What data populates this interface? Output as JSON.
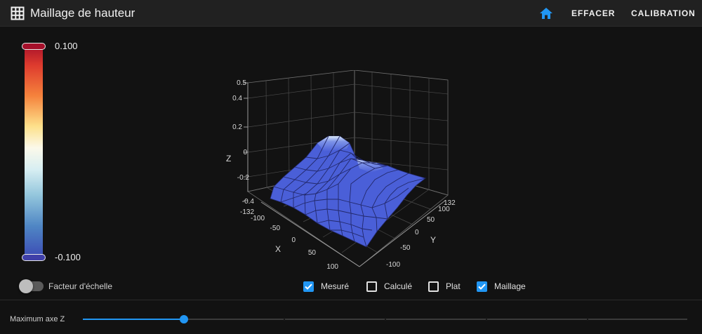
{
  "toolbar": {
    "title": "Maillage de hauteur",
    "effacer_label": "EFFACER",
    "calibration_label": "CALIBRATION",
    "home_icon": "home-icon",
    "title_icon": "grid-icon",
    "accent": "#2196f3"
  },
  "legend": {
    "max_label": "0.100",
    "min_label": "-0.100",
    "scale_label": "Facteur d'échelle",
    "scale_enabled": false
  },
  "options": {
    "mesure": {
      "label": "Mesuré",
      "checked": true
    },
    "calcule": {
      "label": "Calculé",
      "checked": false
    },
    "plat": {
      "label": "Plat",
      "checked": false
    },
    "maillage": {
      "label": "Maillage",
      "checked": true
    }
  },
  "slider": {
    "label": "Maximum axe Z",
    "value_fraction": 0.167
  },
  "chart_data": {
    "type": "surface3d",
    "axes": {
      "x": {
        "label": "X",
        "ticks": [
          "-132",
          "-100",
          "-50",
          "0",
          "50",
          "100"
        ]
      },
      "y": {
        "label": "Y",
        "ticks": [
          "-100",
          "-50",
          "0",
          "50",
          "100",
          "132"
        ]
      },
      "z": {
        "label": "Z",
        "ticks": [
          "-0.4",
          "-0.2",
          "0",
          "0.2",
          "0.4",
          "0.5"
        ]
      }
    },
    "xlim": [
      -132,
      132
    ],
    "ylim": [
      -132,
      132
    ],
    "zlim": [
      -0.5,
      0.5
    ],
    "grid": true,
    "surface_color": "#4a5fd8",
    "surface_approx_z": [
      [
        -0.35,
        -0.33,
        -0.3,
        -0.25,
        -0.2,
        -0.18,
        -0.2
      ],
      [
        -0.33,
        -0.3,
        -0.25,
        -0.18,
        -0.12,
        -0.1,
        -0.12
      ],
      [
        -0.3,
        -0.25,
        -0.17,
        -0.08,
        -0.03,
        -0.02,
        -0.04
      ],
      [
        -0.28,
        -0.22,
        -0.12,
        0.0,
        0.06,
        0.04,
        0.0
      ],
      [
        -0.3,
        -0.24,
        -0.12,
        0.02,
        0.1,
        0.06,
        0.0
      ],
      [
        -0.32,
        -0.26,
        -0.15,
        -0.02,
        0.05,
        0.02,
        -0.02
      ],
      [
        -0.34,
        -0.3,
        -0.2,
        -0.08,
        -0.02,
        -0.04,
        -0.06
      ]
    ]
  }
}
